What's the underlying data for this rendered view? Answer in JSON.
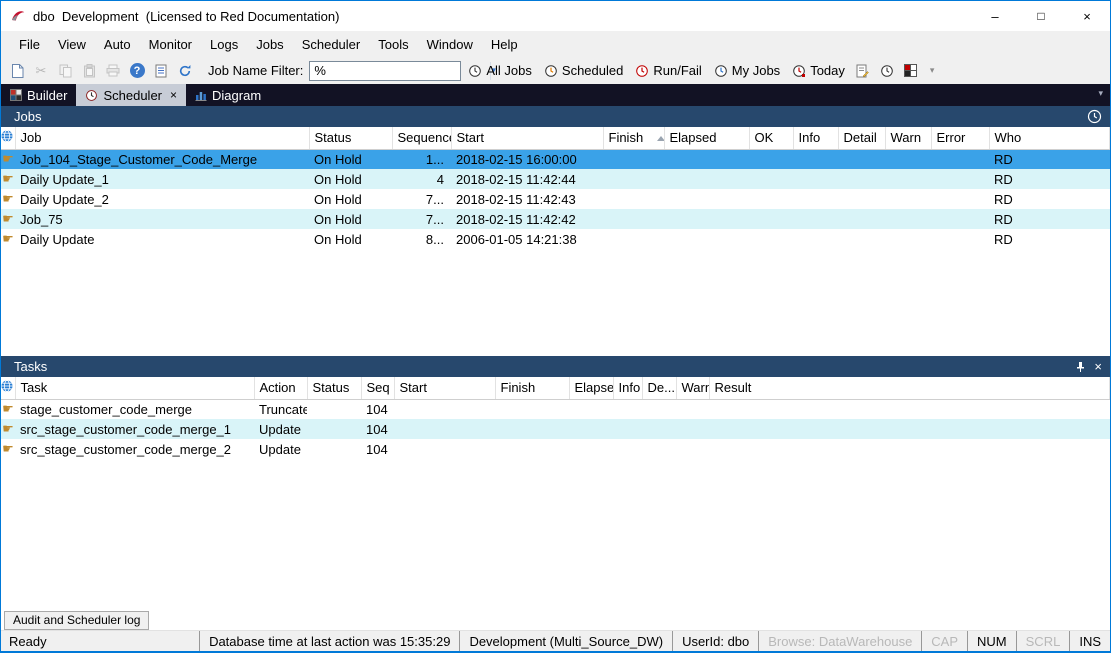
{
  "window": {
    "title": "dbo  Development  (Licensed to Red Documentation)",
    "minimize": "–",
    "maximize": "□",
    "close": "×"
  },
  "menu": [
    "File",
    "View",
    "Auto",
    "Monitor",
    "Logs",
    "Jobs",
    "Scheduler",
    "Tools",
    "Window",
    "Help"
  ],
  "toolbar": {
    "filter_label": "Job Name Filter:",
    "filter_value": "%",
    "all_jobs": "All Jobs",
    "scheduled": "Scheduled",
    "run_fail": "Run/Fail",
    "my_jobs": "My Jobs",
    "today": "Today"
  },
  "tabs": {
    "builder": "Builder",
    "scheduler": "Scheduler",
    "scheduler_close": "×",
    "diagram": "Diagram"
  },
  "jobs": {
    "panel_title": "Jobs",
    "columns": {
      "job": "Job",
      "status": "Status",
      "sequence": "Sequence",
      "start": "Start",
      "finish": "Finish",
      "elapsed": "Elapsed",
      "ok": "OK",
      "info": "Info",
      "detail": "Detail",
      "warn": "Warn",
      "error": "Error",
      "who": "Who"
    },
    "rows": [
      {
        "job": "Job_104_Stage_Customer_Code_Merge",
        "status": "On Hold",
        "sequence": "1...",
        "start": "2018-02-15 16:00:00",
        "finish": "",
        "elapsed": "",
        "ok": "",
        "info": "",
        "detail": "",
        "warn": "",
        "error": "",
        "who": "RD"
      },
      {
        "job": "Daily Update_1",
        "status": "On Hold",
        "sequence": "4",
        "start": "2018-02-15 11:42:44",
        "finish": "",
        "elapsed": "",
        "ok": "",
        "info": "",
        "detail": "",
        "warn": "",
        "error": "",
        "who": "RD"
      },
      {
        "job": "Daily Update_2",
        "status": "On Hold",
        "sequence": "7...",
        "start": "2018-02-15 11:42:43",
        "finish": "",
        "elapsed": "",
        "ok": "",
        "info": "",
        "detail": "",
        "warn": "",
        "error": "",
        "who": "RD"
      },
      {
        "job": "Job_75",
        "status": "On Hold",
        "sequence": "7...",
        "start": "2018-02-15 11:42:42",
        "finish": "",
        "elapsed": "",
        "ok": "",
        "info": "",
        "detail": "",
        "warn": "",
        "error": "",
        "who": "RD"
      },
      {
        "job": "Daily Update",
        "status": "On Hold",
        "sequence": "8...",
        "start": "2006-01-05 14:21:38",
        "finish": "",
        "elapsed": "",
        "ok": "",
        "info": "",
        "detail": "",
        "warn": "",
        "error": "",
        "who": "RD"
      }
    ]
  },
  "tasks": {
    "panel_title": "Tasks",
    "columns": {
      "task": "Task",
      "action": "Action",
      "status": "Status",
      "seq": "Seq",
      "start": "Start",
      "finish": "Finish",
      "elapsed": "Elapsed",
      "info": "Info",
      "detail": "De...",
      "warn": "Warn",
      "result": "Result"
    },
    "rows": [
      {
        "task": "stage_customer_code_merge",
        "action": "Truncate",
        "status": "",
        "seq": "104",
        "start": "",
        "finish": "",
        "elapsed": "",
        "info": "",
        "detail": "",
        "warn": "",
        "result": ""
      },
      {
        "task": "src_stage_customer_code_merge_1",
        "action": "Update",
        "status": "",
        "seq": "104",
        "start": "",
        "finish": "",
        "elapsed": "",
        "info": "",
        "detail": "",
        "warn": "",
        "result": ""
      },
      {
        "task": "src_stage_customer_code_merge_2",
        "action": "Update",
        "status": "",
        "seq": "104",
        "start": "",
        "finish": "",
        "elapsed": "",
        "info": "",
        "detail": "",
        "warn": "",
        "result": ""
      }
    ]
  },
  "bottom_tab": "Audit and Scheduler log",
  "status": {
    "ready": "Ready",
    "db_time": "Database time at last action was 15:35:29",
    "env": "Development (Multi_Source_DW)",
    "user": "UserId: dbo",
    "browse": "Browse: DataWarehouse",
    "cap": "CAP",
    "num": "NUM",
    "scrl": "SCRL",
    "ins": "INS"
  },
  "icons": {
    "hand": "☛",
    "help": "?",
    "cut": "✂",
    "dropdown": "▾",
    "overflow": "▾"
  },
  "colors": {
    "accent": "#0079d8",
    "selection": "#3aa2e8",
    "zebra": "#d9f4f8",
    "panel_header": "#27486d",
    "tabstrip": "#121224"
  }
}
